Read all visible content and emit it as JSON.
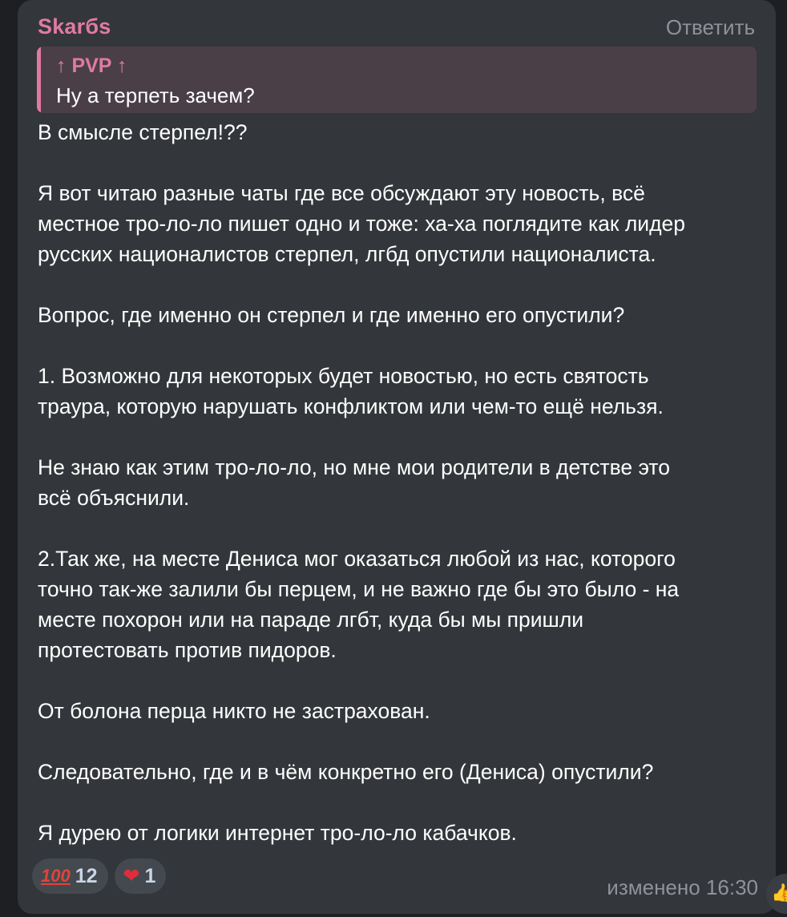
{
  "message": {
    "sender": "Skarбs",
    "reply_action": "Ответить",
    "quote": {
      "author": "↑ PVP ↑",
      "text": "Ну а терпеть зачем?"
    },
    "paragraphs": [
      "В смысле стерпел!??",
      "Я вот читаю разные чаты где все обсуждают эту новость, всё\nместное тро-ло-ло пишет одно и тоже: ха-ха поглядите как лидер\nрусских националистов стерпел, лгбд опустили националиста.",
      "Вопрос, где именно он стерпел и где именно его опустили?",
      "1. Возможно для некоторых будет новостью, но есть святость\nтраура, которую нарушать конфликтом или чем-то ещё нельзя.",
      "Не знаю как этим тро-ло-ло, но мне мои родители в детстве это\nвсё объяснили.",
      "2.Так же, на месте Дениса мог оказаться любой из нас, которого\nточно так-же залили бы перцем, и не важно где бы это было - на\nместе похорон или на параде лгбт, куда бы мы пришли\nпротестовать против пидоров.",
      "От болона перца никто не застрахован.",
      "Следовательно, где и в чём конкретно его (Дениса) опустили?",
      "Я дурею от логики интернет тро-ло-ло кабачков."
    ],
    "reactions": [
      {
        "emoji": "100",
        "icon": "hundred-points-icon",
        "count": "12"
      },
      {
        "emoji": "❤",
        "icon": "heart-icon",
        "count": "1"
      }
    ],
    "meta": "изменено 16:30",
    "colors": {
      "accent": "#e07aa2",
      "bubble": "#33363a",
      "quote_bg": "#4a3f47",
      "muted": "#8f9399"
    }
  }
}
